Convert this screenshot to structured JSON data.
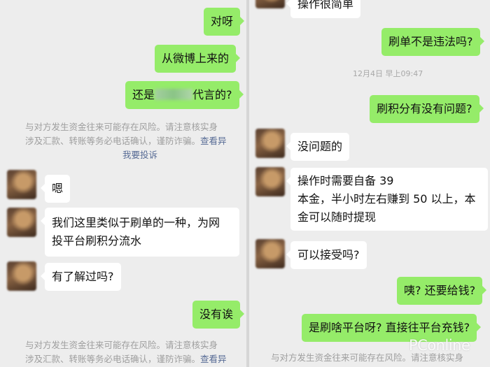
{
  "left_chat": {
    "msg_duiya": "对呀",
    "msg_weibo": "从微博上来的",
    "msg_daiyan_before": "还是",
    "msg_daiyan_after": "代言的?",
    "risk_note_1": {
      "line1": "与对方发生资金往来可能存在风险。请注意核实身",
      "line2": "涉及汇款、转账等务必电话确认，谨防诈骗。",
      "link_view": "查看异",
      "link_report": "我要投诉"
    },
    "msg_en": "嗯",
    "msg_shuadan_line1": "我们这里类似于刷单的一种，为网",
    "msg_shuadan_line2": "投平台刷积分流水",
    "msg_liaojie": "有了解过吗?",
    "msg_meiyou": "没有诶",
    "risk_note_2": {
      "line1": "与对方发生资金往来可能存在风险。请注意核实身",
      "line2": "涉及汇款、转账等务必电话确认，谨防诈骗。",
      "link_view": "查看异"
    }
  },
  "right_chat": {
    "msg_caozuo_partial": "操作很简单",
    "msg_weifa": "刷单不是违法吗?",
    "timestamp": "12月4日 早上09:47",
    "msg_wenti": "刷积分有没有问题?",
    "msg_meiwenti": "没问题的",
    "msg_zibei_line1": "操作时需要自备 39",
    "msg_zibei_line2": "本金，半小时左右赚到 50 以上，本",
    "msg_zibei_line3": "金可以随时提现",
    "msg_jieshou": "可以接受吗?",
    "msg_geiqian": "咦? 还要给钱?",
    "msg_pingtai": "是刷啥平台呀? 直接往平台充钱?",
    "risk_note_bottom": "与对方发生资金往来可能存在风险。请注意核实身"
  },
  "watermark": "PConline"
}
